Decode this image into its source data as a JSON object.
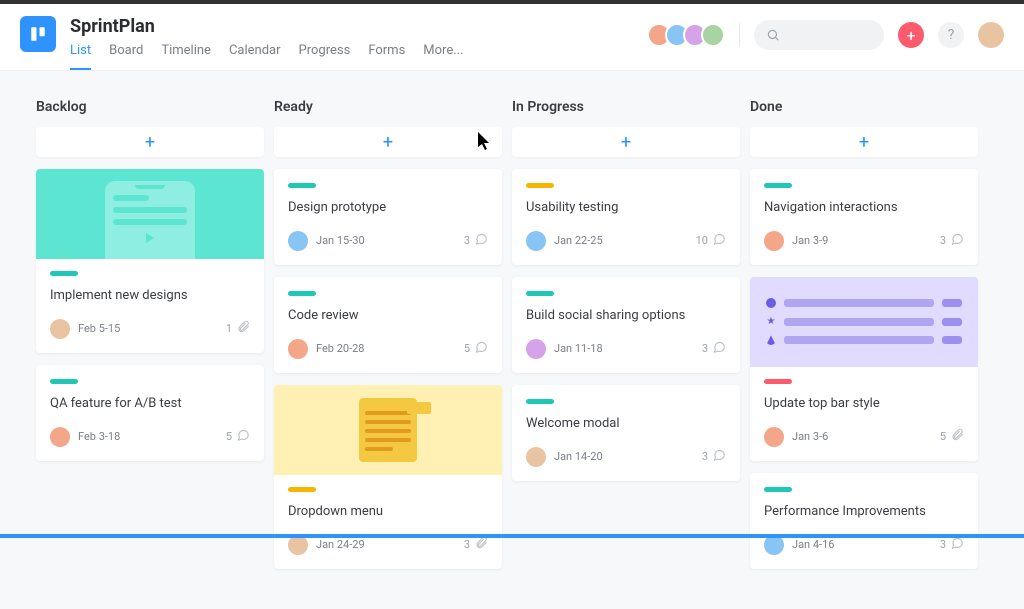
{
  "header": {
    "title": "SprintPlan",
    "tabs": [
      {
        "label": "List",
        "active": true
      },
      {
        "label": "Board",
        "active": false
      },
      {
        "label": "Timeline",
        "active": false
      },
      {
        "label": "Calendar",
        "active": false
      },
      {
        "label": "Progress",
        "active": false
      },
      {
        "label": "Forms",
        "active": false
      },
      {
        "label": "More...",
        "active": false
      }
    ],
    "add_label": "+",
    "help_label": "?"
  },
  "columns": [
    {
      "title": "Backlog",
      "cards": [
        {
          "stripe": "teal",
          "title": "Implement new designs",
          "date": "Feb 5-15",
          "count": "1",
          "icon": "attach",
          "avatar": "av5",
          "cover": "teal-phone"
        },
        {
          "stripe": "teal",
          "title": "QA feature for A/B test",
          "date": "Feb 3-18",
          "count": "5",
          "icon": "comment",
          "avatar": "av1",
          "cover": null
        }
      ]
    },
    {
      "title": "Ready",
      "cards": [
        {
          "stripe": "teal",
          "title": "Design prototype",
          "date": "Jan 15-30",
          "count": "3",
          "icon": "comment",
          "avatar": "av2",
          "cover": null
        },
        {
          "stripe": "teal",
          "title": "Code review",
          "date": "Feb 20-28",
          "count": "5",
          "icon": "comment",
          "avatar": "av1",
          "cover": null
        },
        {
          "stripe": "orange",
          "title": "Dropdown menu",
          "date": "Jan 24-29",
          "count": "3",
          "icon": "attach",
          "avatar": "av5",
          "cover": "yellow-doc"
        }
      ]
    },
    {
      "title": "In Progress",
      "cards": [
        {
          "stripe": "orange",
          "title": "Usability testing",
          "date": "Jan 22-25",
          "count": "10",
          "icon": "comment",
          "avatar": "av2",
          "cover": null
        },
        {
          "stripe": "teal",
          "title": "Build social sharing options",
          "date": "Jan 11-18",
          "count": "3",
          "icon": "comment",
          "avatar": "av3",
          "cover": null
        },
        {
          "stripe": "teal",
          "title": "Welcome modal",
          "date": "Jan 14-20",
          "count": "3",
          "icon": "comment",
          "avatar": "av5",
          "cover": null
        }
      ]
    },
    {
      "title": "Done",
      "cards": [
        {
          "stripe": "teal",
          "title": "Navigation interactions",
          "date": "Jan 3-9",
          "count": "3",
          "icon": "comment",
          "avatar": "av1",
          "cover": null
        },
        {
          "stripe": "red",
          "title": "Update top bar style",
          "date": "Jan 3-6",
          "count": "5",
          "icon": "attach",
          "avatar": "av1",
          "cover": "purple-list"
        },
        {
          "stripe": "teal",
          "title": "Performance Improvements",
          "date": "Jan 4-16",
          "count": "3",
          "icon": "comment",
          "avatar": "av2",
          "cover": null
        }
      ]
    }
  ]
}
